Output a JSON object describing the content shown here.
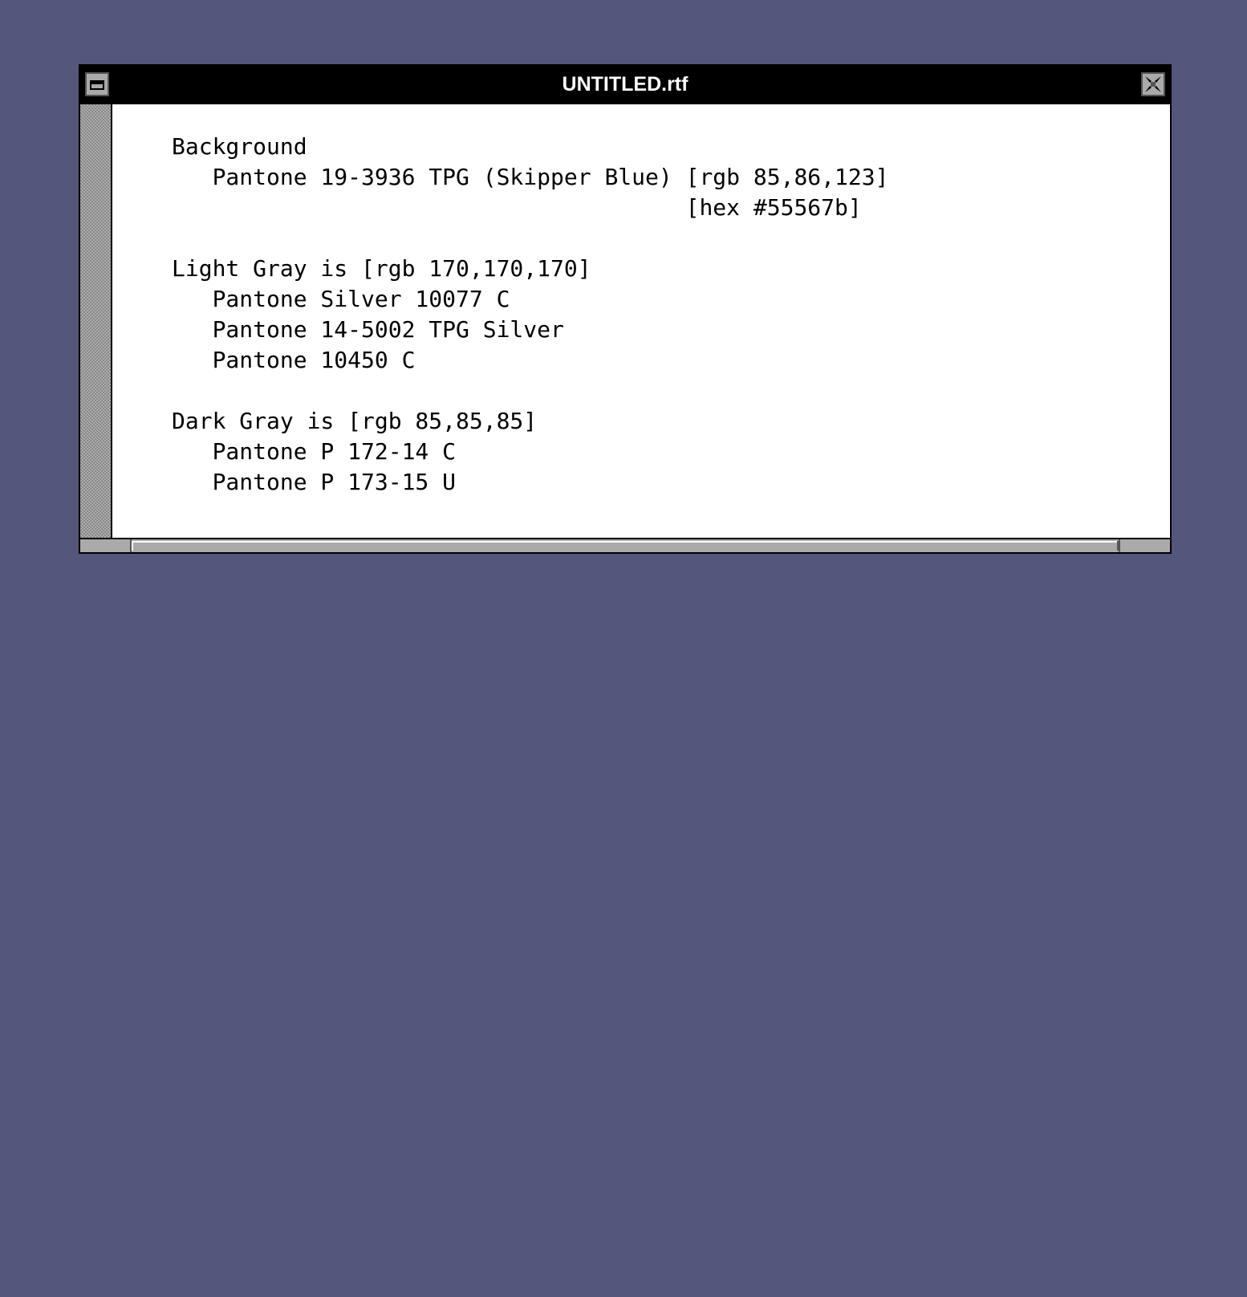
{
  "desktop": {
    "background_color": "#55567b"
  },
  "window": {
    "title": "UNTITLED.rtf",
    "menu_icon": "window-menu-icon",
    "close_icon": "close-icon"
  },
  "document": {
    "lines": [
      "Background",
      "   Pantone 19-3936 TPG (Skipper Blue) [rgb 85,86,123]",
      "                                      [hex #55567b]",
      "",
      "Light Gray is [rgb 170,170,170]",
      "   Pantone Silver 10077 C",
      "   Pantone 14-5002 TPG Silver",
      "   Pantone 10450 C",
      "",
      "Dark Gray is [rgb 85,85,85]",
      "   Pantone P 172-14 C",
      "   Pantone P 173-15 U"
    ]
  }
}
